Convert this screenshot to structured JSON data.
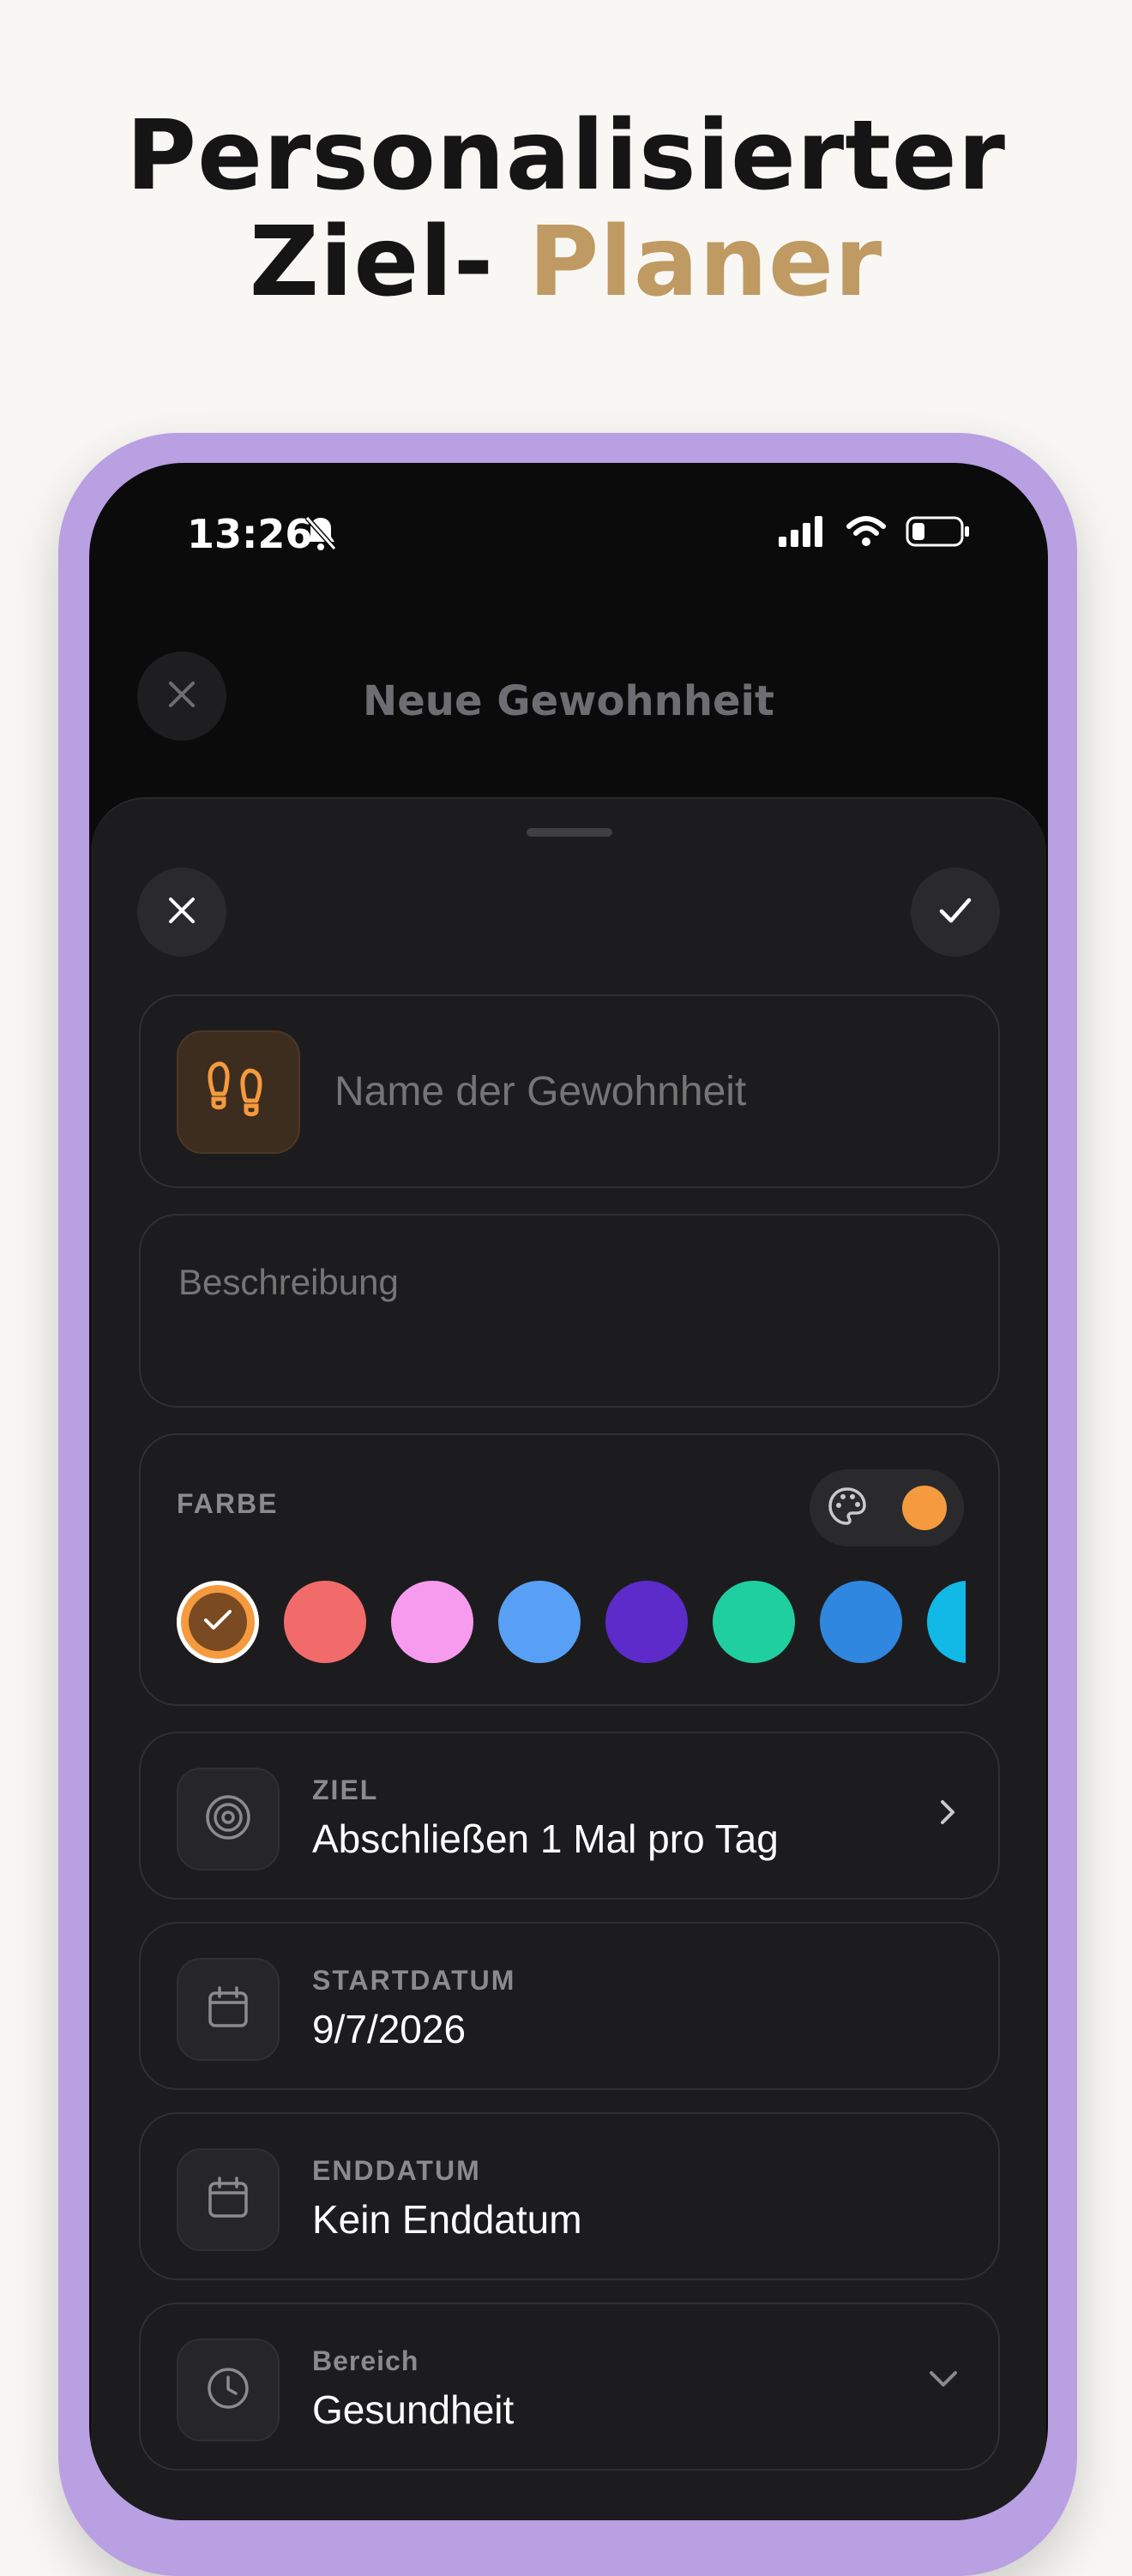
{
  "headline": {
    "line1": "Personalisierter",
    "line2_prefix": "Ziel-",
    "line2_accent": "Planer"
  },
  "status_bar": {
    "time": "13:26"
  },
  "background_nav": {
    "title": "Neue Gewohnheit"
  },
  "form": {
    "name_placeholder": "Name der Gewohnheit",
    "description_placeholder": "Beschreibung",
    "color_section": {
      "label": "FARBE",
      "selected_color": "#f59a3e",
      "swatches": [
        "#f59a3e",
        "#f26b6b",
        "#f79bef",
        "#58a0f5",
        "#5c2bc9",
        "#20cfa0",
        "#2f87e0",
        "#12b8e6"
      ]
    },
    "rows": [
      {
        "label": "ZIEL",
        "value": "Abschließen 1 Mal pro Tag",
        "icon": "target-icon",
        "accessory": "chevron-right-icon"
      },
      {
        "label": "STARTDATUM",
        "value": "9/7/2026",
        "icon": "calendar-icon",
        "accessory": ""
      },
      {
        "label": "ENDDATUM",
        "value": "Kein Enddatum",
        "icon": "calendar-icon",
        "accessory": ""
      },
      {
        "label": "Bereich",
        "value": "Gesundheit",
        "icon": "clock-icon",
        "accessory": "chevron-down-icon"
      }
    ]
  },
  "colors": {
    "accent_headline": "#bf9a63",
    "frame": "#b8a0e2",
    "habit_icon": "#f59a3e"
  }
}
